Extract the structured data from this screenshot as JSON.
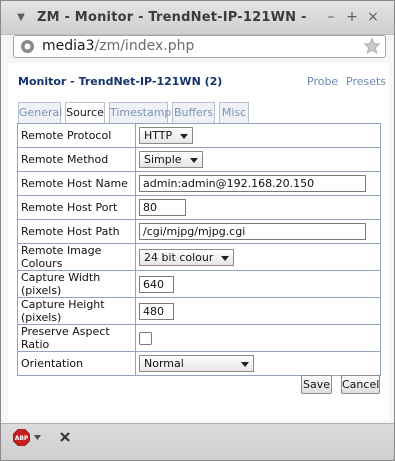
{
  "window": {
    "title": "ZM - Monitor - TrendNet-IP-121WN -"
  },
  "browser": {
    "url_host": "media3",
    "url_path": "/zm/index.php"
  },
  "page": {
    "heading": "Monitor - TrendNet-IP-121WN (2)",
    "links": {
      "probe": "Probe",
      "presets": "Presets"
    },
    "tabs": [
      {
        "label": "General",
        "active": false
      },
      {
        "label": "Source",
        "active": true
      },
      {
        "label": "Timestamp",
        "active": false
      },
      {
        "label": "Buffers",
        "active": false
      },
      {
        "label": "Misc",
        "active": false
      }
    ],
    "fields": {
      "remote_protocol": {
        "label": "Remote Protocol",
        "value": "HTTP"
      },
      "remote_method": {
        "label": "Remote Method",
        "value": "Simple"
      },
      "remote_host_name": {
        "label": "Remote Host Name",
        "value": "admin:admin@192.168.20.150"
      },
      "remote_host_port": {
        "label": "Remote Host Port",
        "value": "80"
      },
      "remote_host_path": {
        "label": "Remote Host Path",
        "value": "/cgi/mjpg/mjpg.cgi"
      },
      "remote_image_colours": {
        "label": "Remote Image Colours",
        "value": "24 bit colour"
      },
      "capture_width": {
        "label": "Capture Width (pixels)",
        "value": "640"
      },
      "capture_height": {
        "label": "Capture Height (pixels)",
        "value": "480"
      },
      "preserve_aspect_ratio": {
        "label": "Preserve Aspect Ratio",
        "checked": false
      },
      "orientation": {
        "label": "Orientation",
        "value": "Normal"
      }
    },
    "buttons": {
      "save": "Save",
      "cancel": "Cancel"
    }
  },
  "statusbar": {
    "icons": [
      "abp-icon",
      "chevron-down-icon",
      "close-icon"
    ]
  },
  "colors": {
    "heading": "#16336a",
    "link": "#6a8ab5",
    "table_border": "#93a3bb",
    "abp_red": "#c51f1f"
  }
}
